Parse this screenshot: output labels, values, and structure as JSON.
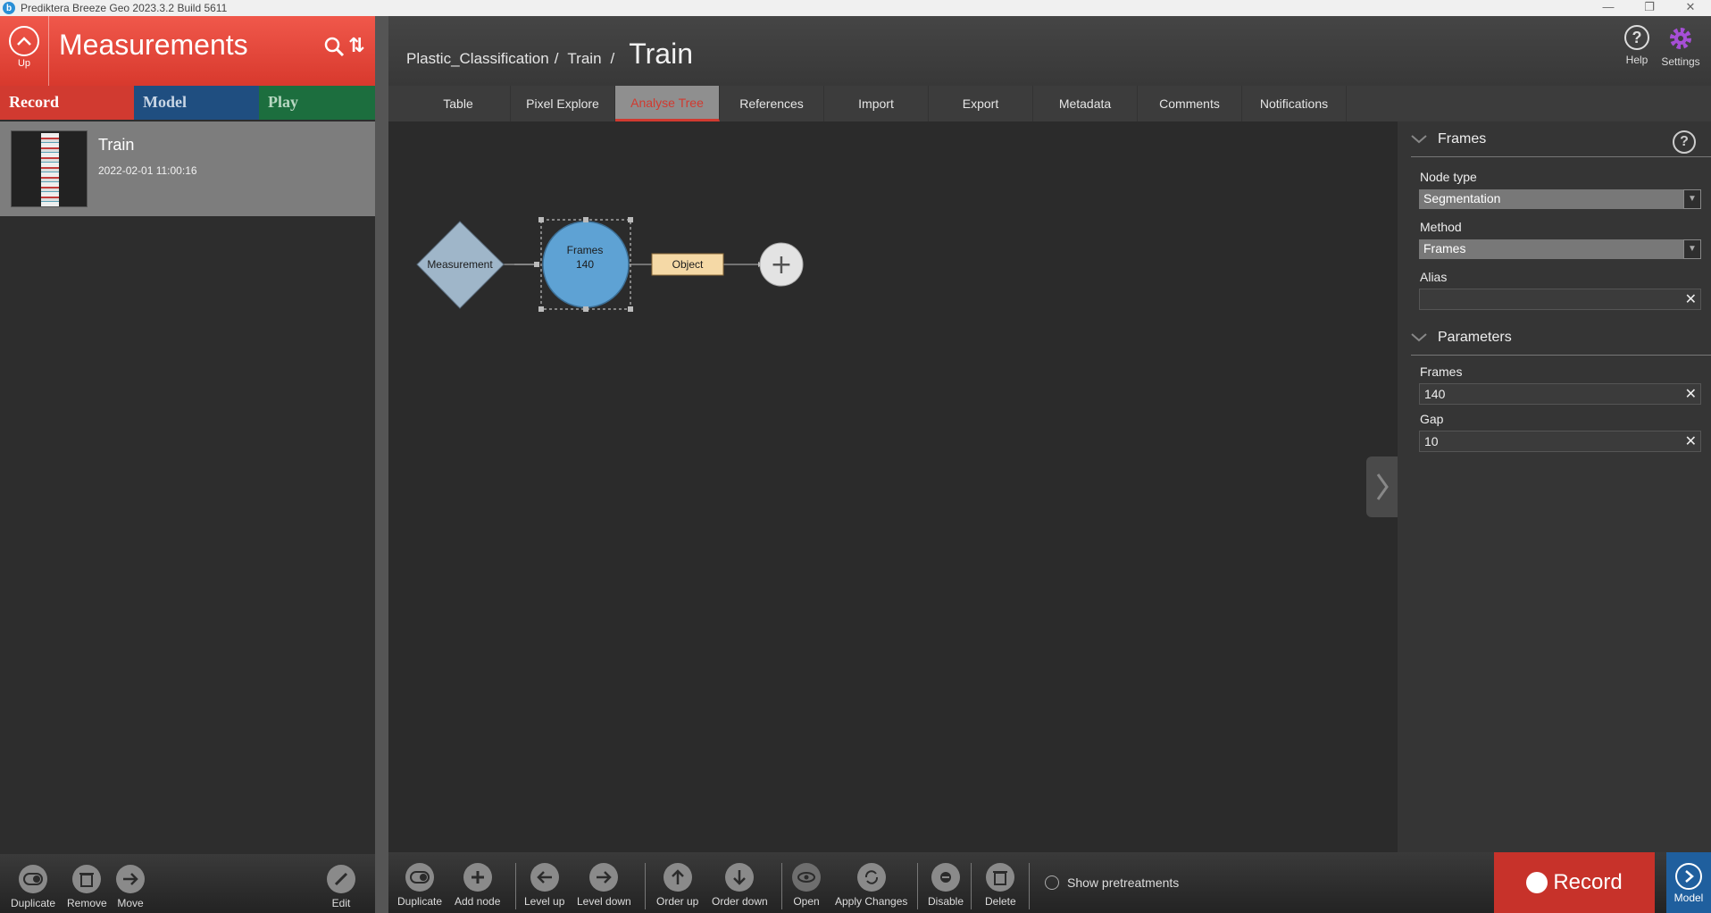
{
  "window": {
    "title": "Prediktera Breeze Geo 2023.3.2 Build 5611",
    "logo_letter": "b",
    "min": "—",
    "restore": "❐",
    "close": "✕"
  },
  "left_panel": {
    "up_label": "Up",
    "title": "Measurements",
    "sort_glyph": "⇅",
    "mode_tabs": {
      "record": "Record",
      "model": "Model",
      "play": "Play"
    },
    "item": {
      "name": "Train",
      "date": "2022-02-01 11:00:16"
    },
    "footer": {
      "duplicate": "Duplicate",
      "remove": "Remove",
      "move": "Move",
      "edit": "Edit"
    }
  },
  "header": {
    "breadcrumb": {
      "project": "Plastic_Classification",
      "group": "Train",
      "current": "Train"
    },
    "help": "Help",
    "settings": "Settings"
  },
  "tabs": [
    "Table",
    "Pixel Explore",
    "Analyse Tree",
    "References",
    "Import",
    "Export",
    "Metadata",
    "Comments",
    "Notifications"
  ],
  "active_tab": "Analyse Tree",
  "graph": {
    "measurement_label": "Measurement",
    "frames_label": "Frames",
    "frames_value": "140",
    "object_label": "Object",
    "add_glyph": "+"
  },
  "properties": {
    "frames_section": "Frames",
    "node_type_label": "Node type",
    "node_type_value": "Segmentation",
    "method_label": "Method",
    "method_value": "Frames",
    "alias_label": "Alias",
    "alias_value": "",
    "parameters_section": "Parameters",
    "frames_param_label": "Frames",
    "frames_param_value": "140",
    "gap_label": "Gap",
    "gap_value": "10"
  },
  "toolbar": {
    "duplicate": "Duplicate",
    "add_node": "Add node",
    "level_up": "Level up",
    "level_down": "Level down",
    "order_up": "Order up",
    "order_down": "Order down",
    "open": "Open",
    "apply_changes": "Apply Changes",
    "disable": "Disable",
    "delete": "Delete",
    "show_pretreatments": "Show pretreatments",
    "record": "Record",
    "model": "Model"
  },
  "colors": {
    "accent_red": "#d13a30",
    "model_blue": "#1f4e80",
    "play_green": "#1c6e3e",
    "frames_node": "#5ea2d4",
    "measurement_node": "#9fb6c9",
    "object_node": "#f5d9a6",
    "settings_icon": "#a64fd6"
  }
}
